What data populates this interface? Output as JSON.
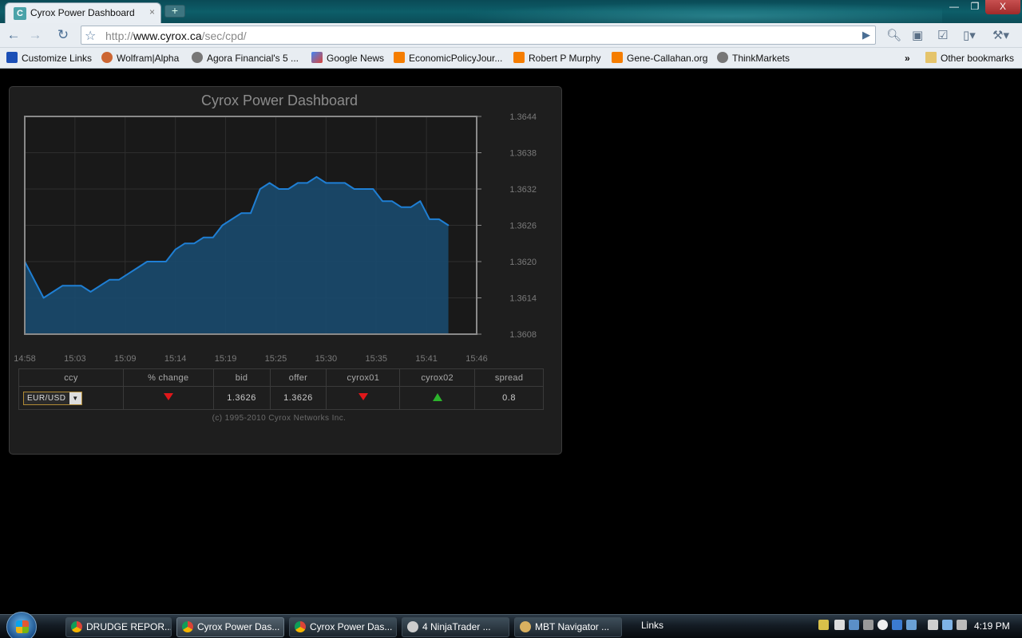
{
  "browser": {
    "tab_title": "Cyrox Power Dashboard",
    "tab_close": "×",
    "new_tab": "+",
    "url_prefix": "http://",
    "url_host": "www.cyrox.ca",
    "url_path": "/sec/cpd/",
    "window_controls": [
      "—",
      "❐",
      "X"
    ]
  },
  "bookmarks": [
    {
      "label": "Customize Links",
      "icon": "customize-links-icon"
    },
    {
      "label": "Wolfram|Alpha",
      "icon": "wolfram-icon"
    },
    {
      "label": "Agora Financial's 5 ...",
      "icon": "agora-icon"
    },
    {
      "label": "Google News",
      "icon": "google-news-icon"
    },
    {
      "label": "EconomicPolicyJour...",
      "icon": "blogger-icon"
    },
    {
      "label": "Robert P Murphy",
      "icon": "blogger-icon"
    },
    {
      "label": "Gene-Callahan.org",
      "icon": "blogger-icon"
    },
    {
      "label": "ThinkMarkets",
      "icon": "wordpress-icon"
    }
  ],
  "bookmarks_overflow": "»",
  "other_bookmarks": "Other bookmarks",
  "dashboard": {
    "copyright": "(c) 1995-2010 Cyrox Networks Inc.",
    "table": {
      "headers": [
        "ccy",
        "% change",
        "bid",
        "offer",
        "cyrox01",
        "cyrox02",
        "spread"
      ],
      "ccy_selected": "EUR/USD",
      "pct_change_direction": "down",
      "bid": "1.3626",
      "offer": "1.3626",
      "cyrox01_direction": "down",
      "cyrox02_direction": "up",
      "spread": "0.8"
    }
  },
  "chart_data": {
    "type": "area",
    "title": "Cyrox Power Dashboard",
    "xlabel": "",
    "ylabel": "",
    "x_ticks": [
      "14:58",
      "15:03",
      "15:09",
      "15:14",
      "15:19",
      "15:25",
      "15:30",
      "15:35",
      "15:41",
      "15:46"
    ],
    "y_ticks": [
      "1.3644",
      "1.3638",
      "1.3632",
      "1.3626",
      "1.3620",
      "1.3614",
      "1.3608"
    ],
    "ylim": [
      1.3608,
      1.3644
    ],
    "grid": true,
    "series": [
      {
        "values_time": [
          "14:58",
          "14:59",
          "15:00",
          "15:01",
          "15:02",
          "15:03",
          "15:04",
          "15:05",
          "15:06",
          "15:07",
          "15:08",
          "15:09",
          "15:10",
          "15:11",
          "15:12",
          "15:13",
          "15:14",
          "15:15",
          "15:16",
          "15:17",
          "15:18",
          "15:19",
          "15:20",
          "15:21",
          "15:22",
          "15:23",
          "15:24",
          "15:25",
          "15:26",
          "15:27",
          "15:28",
          "15:29",
          "15:30",
          "15:31",
          "15:32",
          "15:33",
          "15:34",
          "15:35",
          "15:36",
          "15:37",
          "15:38",
          "15:39",
          "15:40",
          "15:41",
          "15:42",
          "15:43"
        ],
        "values": [
          1.362,
          1.3617,
          1.3614,
          1.3615,
          1.3616,
          1.3616,
          1.3616,
          1.3615,
          1.3616,
          1.3617,
          1.3617,
          1.3618,
          1.3619,
          1.362,
          1.362,
          1.362,
          1.3622,
          1.3623,
          1.3623,
          1.3624,
          1.3624,
          1.3626,
          1.3627,
          1.3628,
          1.3628,
          1.3632,
          1.3633,
          1.3632,
          1.3632,
          1.3633,
          1.3633,
          1.3634,
          1.3633,
          1.3633,
          1.3633,
          1.3632,
          1.3632,
          1.3632,
          1.363,
          1.363,
          1.3629,
          1.3629,
          1.363,
          1.3627,
          1.3627,
          1.3626
        ]
      }
    ],
    "line_color": "#1f7fd4",
    "fill_color": "#1a4a6e"
  },
  "taskbar": {
    "buttons": [
      {
        "label": "DRUDGE REPOR...",
        "active": false
      },
      {
        "label": "Cyrox Power Das...",
        "active": true
      },
      {
        "label": "Cyrox Power Das...",
        "active": false
      },
      {
        "label": "4 NinjaTrader ...",
        "active": false
      },
      {
        "label": "MBT Navigator ...",
        "active": false
      }
    ],
    "links": "Links",
    "clock": "4:19 PM"
  }
}
